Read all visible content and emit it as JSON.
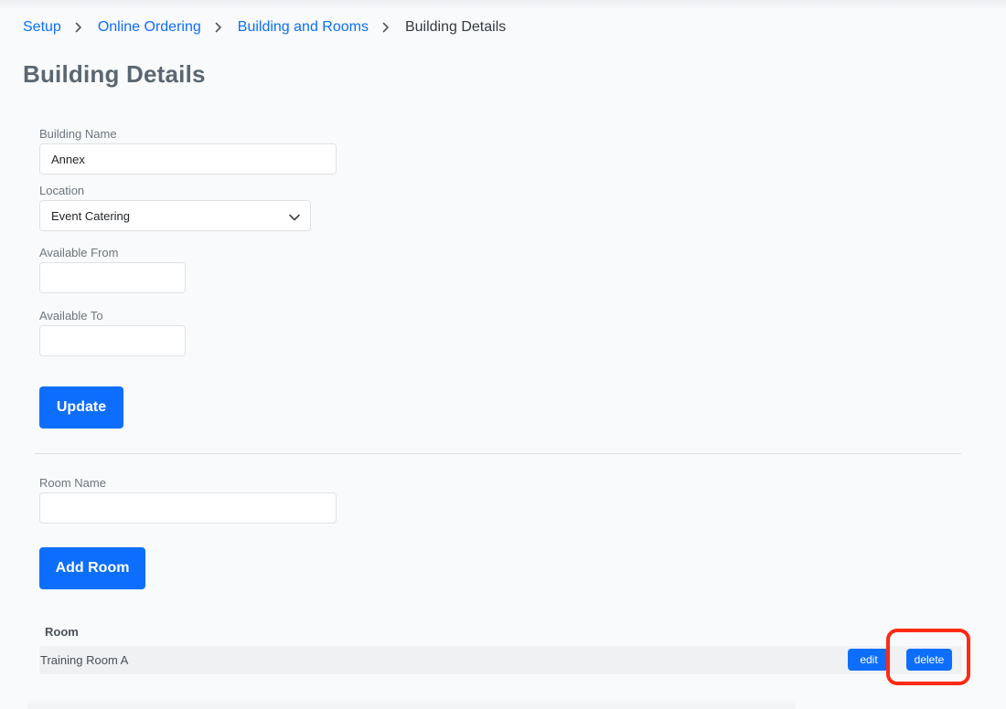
{
  "breadcrumb": {
    "items": [
      {
        "label": "Setup"
      },
      {
        "label": "Online Ordering"
      },
      {
        "label": "Building and Rooms"
      }
    ],
    "current": "Building Details"
  },
  "page_title": "Building Details",
  "form": {
    "building_name": {
      "label": "Building Name",
      "value": "Annex"
    },
    "location": {
      "label": "Location",
      "value": "Event Catering"
    },
    "available_from": {
      "label": "Available From",
      "value": ""
    },
    "available_to": {
      "label": "Available To",
      "value": ""
    },
    "update_label": "Update"
  },
  "room_form": {
    "room_name": {
      "label": "Room Name",
      "value": ""
    },
    "add_room_label": "Add Room"
  },
  "rooms_table": {
    "header": "Room",
    "rows": [
      {
        "name": "Training Room A",
        "edit_label": "edit",
        "delete_label": "delete"
      }
    ]
  },
  "colors": {
    "accent": "#0d6efd",
    "highlight": "#ff2a14"
  },
  "icons": {
    "breadcrumb_separator": "chevron-right-icon",
    "select_caret": "chevron-down-icon"
  }
}
